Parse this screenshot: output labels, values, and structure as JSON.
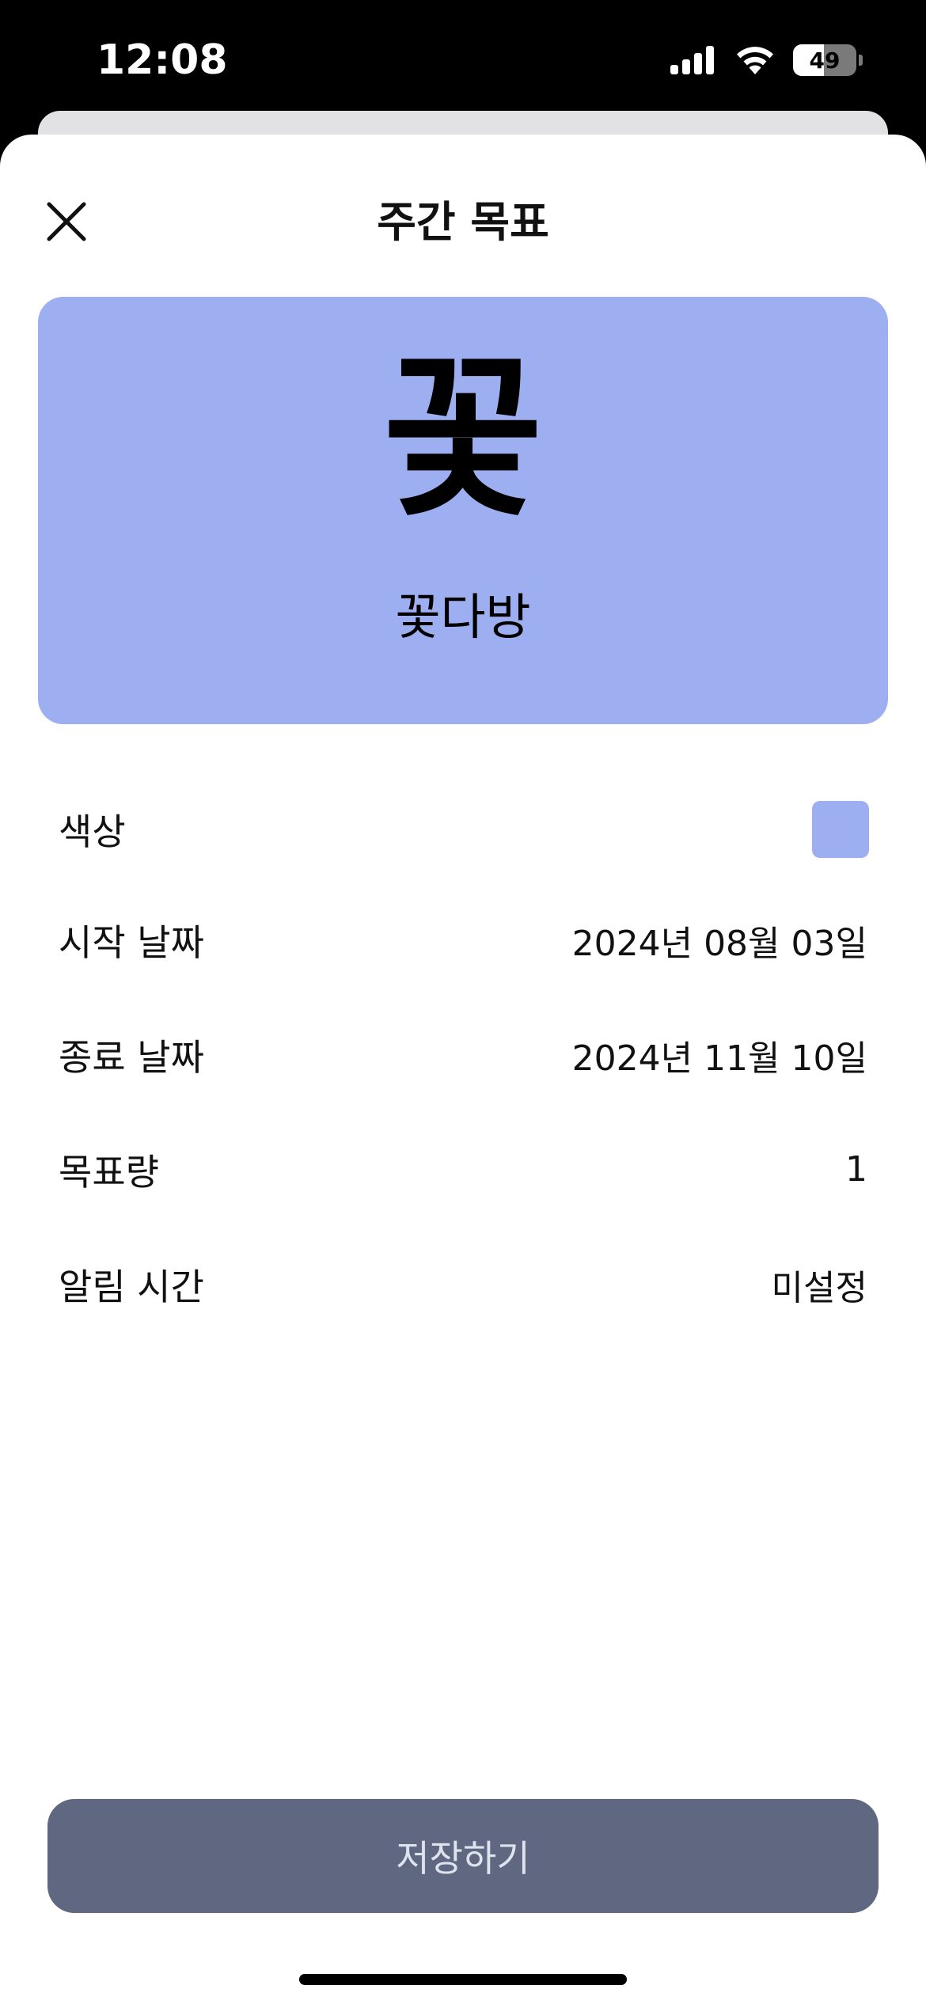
{
  "status_bar": {
    "time": "12:08",
    "battery_level": "49",
    "battery_fraction": 0.49
  },
  "header": {
    "title": "주간 목표",
    "close_icon": "close-icon"
  },
  "preview": {
    "emoji": "꽃",
    "name": "꽃다방",
    "color": "#9daff0"
  },
  "settings": {
    "color": {
      "label": "색상",
      "swatch": "#9daff0"
    },
    "start_date": {
      "label": "시작 날짜",
      "value": "2024년 08월 03일"
    },
    "end_date": {
      "label": "종료 날짜",
      "value": "2024년 11월 10일"
    },
    "goal_amount": {
      "label": "목표량",
      "value": "1"
    },
    "notification_time": {
      "label": "알림 시간",
      "value": "미설정"
    }
  },
  "save_button": {
    "label": "저장하기",
    "background": "#5f6880"
  }
}
